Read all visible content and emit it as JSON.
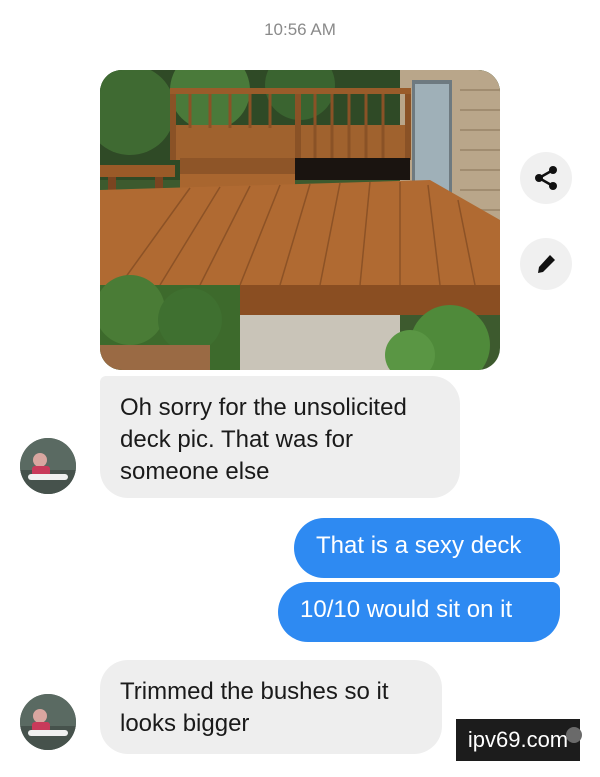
{
  "timestamp": "10:56 AM",
  "messages": [
    {
      "side": "incoming",
      "text": "Oh sorry for the unsolicited\ndeck pic. That was for\nsomeone else"
    },
    {
      "side": "outgoing",
      "text": "That is a sexy deck"
    },
    {
      "side": "outgoing",
      "text": "10/10 would sit on it"
    },
    {
      "side": "incoming",
      "text": "Trimmed the bushes so it\nlooks bigger"
    }
  ],
  "actions": {
    "share_icon": "share-icon",
    "edit_icon": "pencil-icon"
  },
  "watermark": "ipv69.com",
  "colors": {
    "outgoing_bubble": "#2e8af2",
    "incoming_bubble": "#eeeeee",
    "timestamp": "#8a8a8a"
  }
}
